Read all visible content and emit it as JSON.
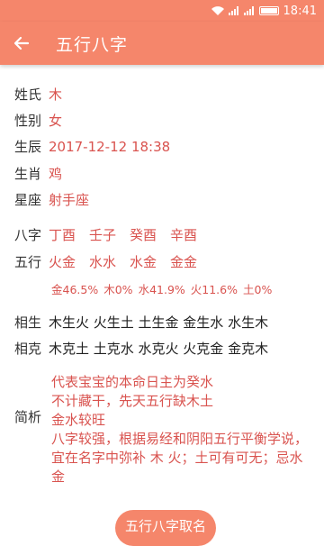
{
  "status": {
    "time": "18:41"
  },
  "header": {
    "title": "五行八字"
  },
  "profile": {
    "name_label": "姓氏",
    "name_value": "木",
    "gender_label": "性别",
    "gender_value": "女",
    "birth_label": "生辰",
    "birth_value": "2017-12-12 18:38",
    "zodiac_label": "生肖",
    "zodiac_value": "鸡",
    "star_label": "星座",
    "star_value": "射手座"
  },
  "bazi": {
    "label": "八字",
    "values": [
      "丁酉",
      "壬子",
      "癸酉",
      "辛酉"
    ]
  },
  "wuxing": {
    "label": "五行",
    "values": [
      "火金",
      "水水",
      "水金",
      "金金"
    ],
    "percents": [
      "金46.5%",
      "木0%",
      "水41.9%",
      "火11.6%",
      "土0%"
    ]
  },
  "xiangsheng": {
    "label": "相生",
    "value": "木生火 火生土 土生金 金生水 水生木"
  },
  "xiangke": {
    "label": "相克",
    "value": "木克土 土克水 水克火 火克金 金克木"
  },
  "analysis": {
    "label": "简析",
    "lines": [
      "代表宝宝的本命日主为癸水",
      "不计藏干，先天五行缺木土",
      "金水较旺",
      "八字较强，根据易经和阴阳五行平衡学说，宜在名字中弥补 木 火；土可有可无；忌水金"
    ]
  },
  "cta": {
    "label": "五行八字取名"
  },
  "colors": {
    "accent": "#f5866b",
    "value_red": "#d9534f"
  }
}
